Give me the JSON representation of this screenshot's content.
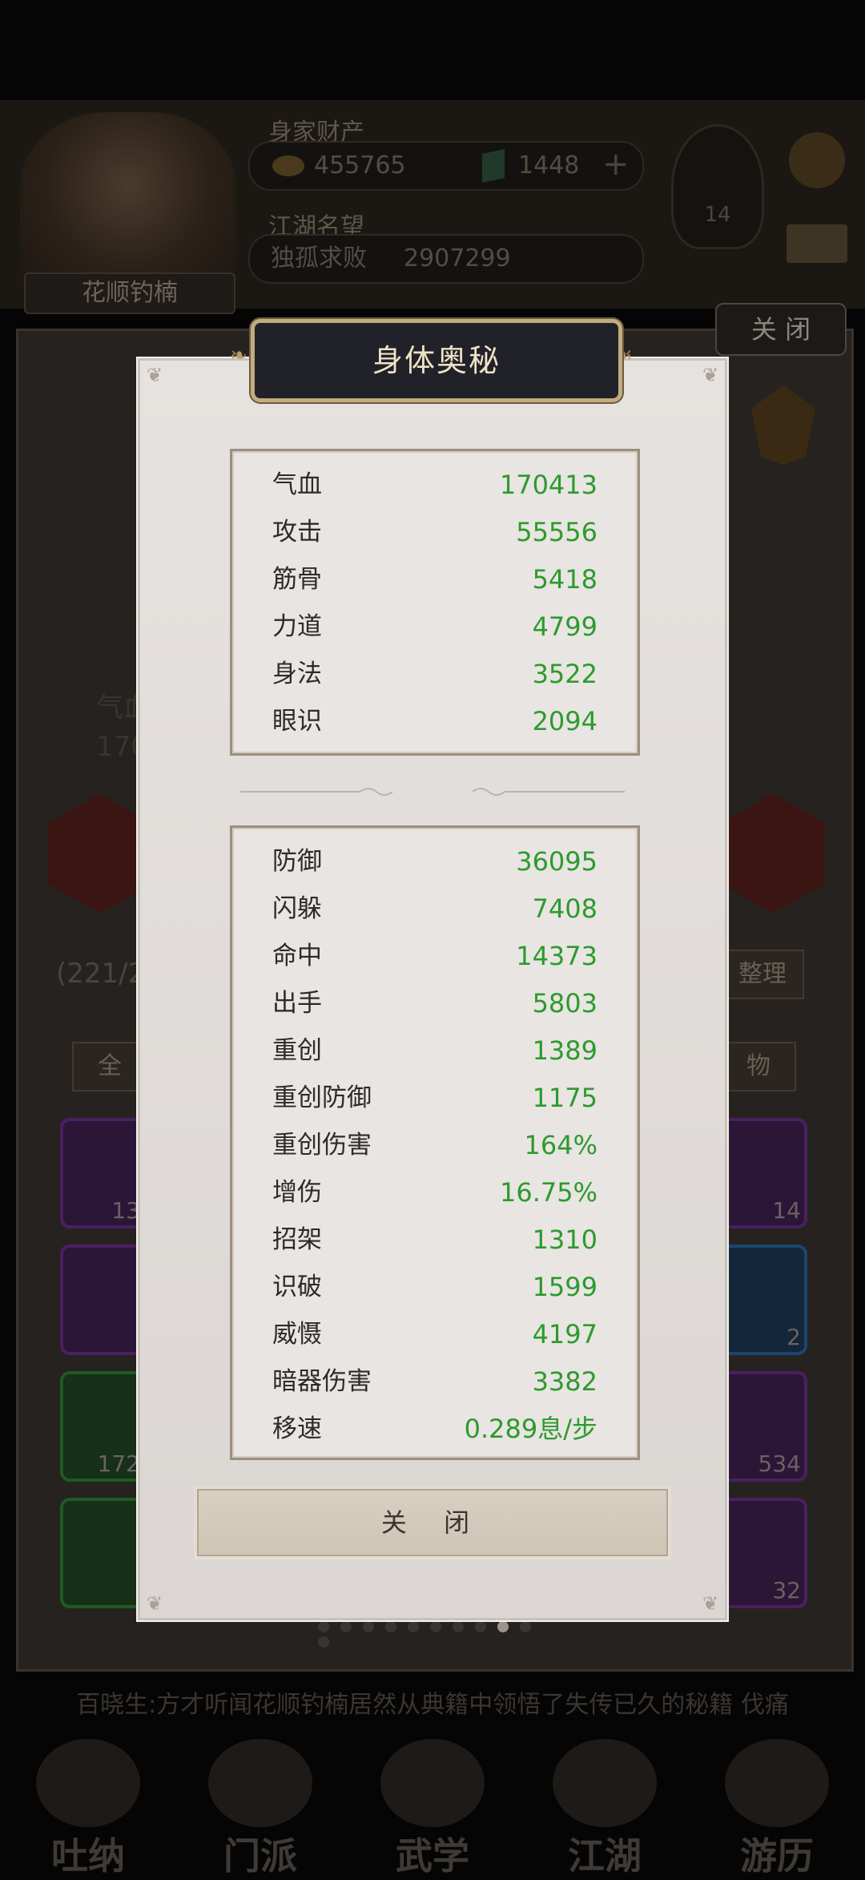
{
  "background": {
    "player_name": "花顺钓楠",
    "wealth_label": "身家财产",
    "coins": "455765",
    "jade": "1448",
    "fame_label": "江湖名望",
    "fame_title": "独孤求败",
    "fame_value": "2907299",
    "level": "14",
    "close_label": "关 闭",
    "stat_partial_1": "气血",
    "stat_partial_2": "170",
    "bag_count": "(221/2",
    "sort_label": "整理",
    "tab_all": "全",
    "tab_item": "物",
    "slot_counts": [
      "13",
      "14",
      "2",
      "172",
      "534",
      "32"
    ],
    "ticker": "百晓生:方才听闻花顺钓楠居然从典籍中领悟了失传已久的秘籍 伐痛",
    "nav": [
      "吐纳",
      "门派",
      "武学",
      "江湖",
      "游历"
    ]
  },
  "dialog": {
    "title": "身体奥秘",
    "primary_stats": [
      {
        "label": "气血",
        "value": "170413"
      },
      {
        "label": "攻击",
        "value": "55556"
      },
      {
        "label": "筋骨",
        "value": "5418"
      },
      {
        "label": "力道",
        "value": "4799"
      },
      {
        "label": "身法",
        "value": "3522"
      },
      {
        "label": "眼识",
        "value": "2094"
      }
    ],
    "secondary_stats": [
      {
        "label": "防御",
        "value": "36095"
      },
      {
        "label": "闪躲",
        "value": "7408"
      },
      {
        "label": "命中",
        "value": "14373"
      },
      {
        "label": "出手",
        "value": "5803"
      },
      {
        "label": "重创",
        "value": "1389"
      },
      {
        "label": "重创防御",
        "value": "1175"
      },
      {
        "label": "重创伤害",
        "value": "164%"
      },
      {
        "label": "增伤",
        "value": "16.75%"
      },
      {
        "label": "招架",
        "value": "1310"
      },
      {
        "label": "识破",
        "value": "1599"
      },
      {
        "label": "威慑",
        "value": "4197"
      },
      {
        "label": "暗器伤害",
        "value": "3382"
      },
      {
        "label": "移速",
        "value": "0.289息/步"
      }
    ],
    "close_button": "关 闭"
  },
  "colors": {
    "stat_value": "#2d9a2d",
    "title_plate": "#21212a",
    "title_border": "#c3ab7e"
  }
}
